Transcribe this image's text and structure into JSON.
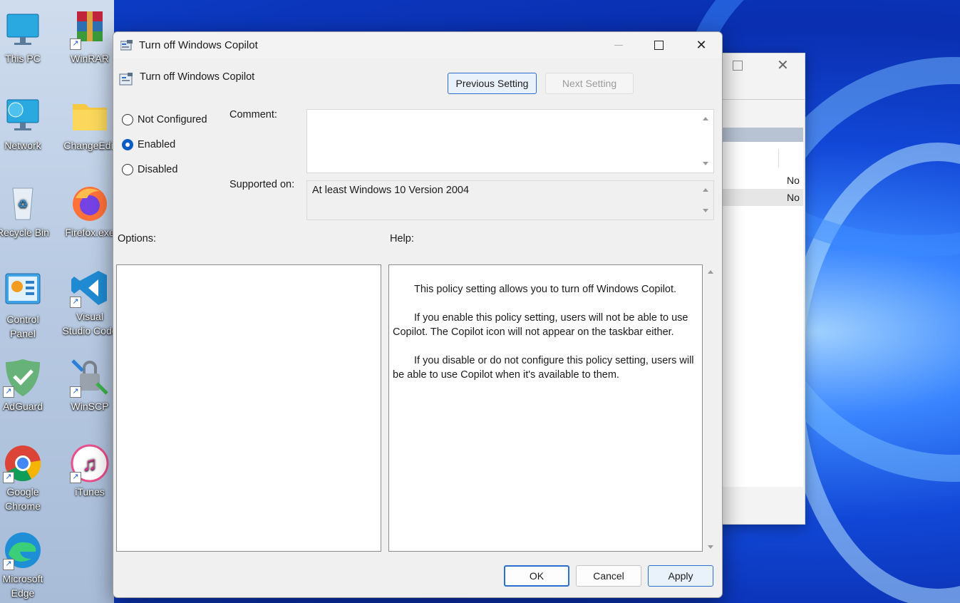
{
  "desktop": {
    "icons": [
      {
        "label": "This PC"
      },
      {
        "label": "WinRAR"
      },
      {
        "label": "Network"
      },
      {
        "label": "ChangeEdit"
      },
      {
        "label": "Recycle Bin"
      },
      {
        "label": "Firefox.exe"
      },
      {
        "label": "Control Panel"
      },
      {
        "label": "Visual Studio Code"
      },
      {
        "label": "AdGuard"
      },
      {
        "label": "WinSCP"
      },
      {
        "label": "Google Chrome"
      },
      {
        "label": "iTunes"
      },
      {
        "label": "Microsoft Edge"
      }
    ]
  },
  "background_window": {
    "row1_text": "No",
    "row2_text": "No"
  },
  "dialog": {
    "title": "Turn off Windows Copilot",
    "setting_name": "Turn off Windows Copilot",
    "previous_setting_label": "Previous Setting",
    "next_setting_label": "Next Setting",
    "state_options": [
      {
        "label": "Not Configured",
        "selected": false
      },
      {
        "label": "Enabled",
        "selected": true
      },
      {
        "label": "Disabled",
        "selected": false
      }
    ],
    "comment_label": "Comment:",
    "comment_value": "",
    "supported_on_label": "Supported on:",
    "supported_on_value": "At least Windows 10 Version 2004",
    "options_label": "Options:",
    "help_label": "Help:",
    "help_paragraphs": [
      "This policy setting allows you to turn off Windows Copilot.",
      "If you enable this policy setting, users will not be able to use Copilot. The Copilot icon will not appear on the taskbar either.",
      "If you disable or do not configure this policy setting, users will be able to use Copilot when it's available to them."
    ],
    "ok_label": "OK",
    "cancel_label": "Cancel",
    "apply_label": "Apply"
  },
  "colors": {
    "accent": "#0a5cc4",
    "dialog_bg": "#f0f0f0"
  }
}
